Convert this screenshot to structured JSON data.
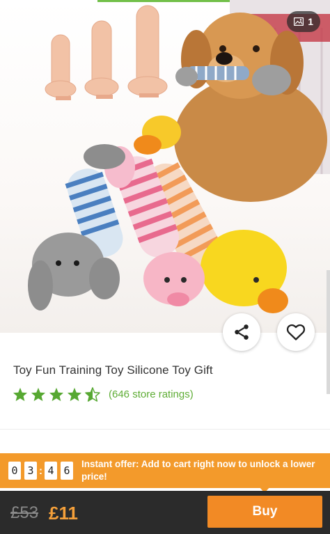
{
  "gallery": {
    "image_count": "1",
    "badge_icon": "image-icon"
  },
  "product": {
    "title": "Toy Fun Training Toy Silicone Toy Gift",
    "rating_value": 4.5,
    "rating_max": 5,
    "ratings_text": "(646 store ratings)"
  },
  "offer": {
    "digits": [
      "0",
      "3",
      "4",
      "6"
    ],
    "text": "Instant offer: Add to cart right now to unlock a lower price!"
  },
  "pricing": {
    "old_price": "£53",
    "new_price": "£11"
  },
  "actions": {
    "buy_label": "Buy"
  },
  "colors": {
    "accent_green": "#5fad36",
    "star_green": "#57a832",
    "offer_orange": "#f39a2b",
    "buy_orange": "#f28a25",
    "price_orange": "#f5a03a",
    "bar_dark": "#2b2b2b"
  }
}
